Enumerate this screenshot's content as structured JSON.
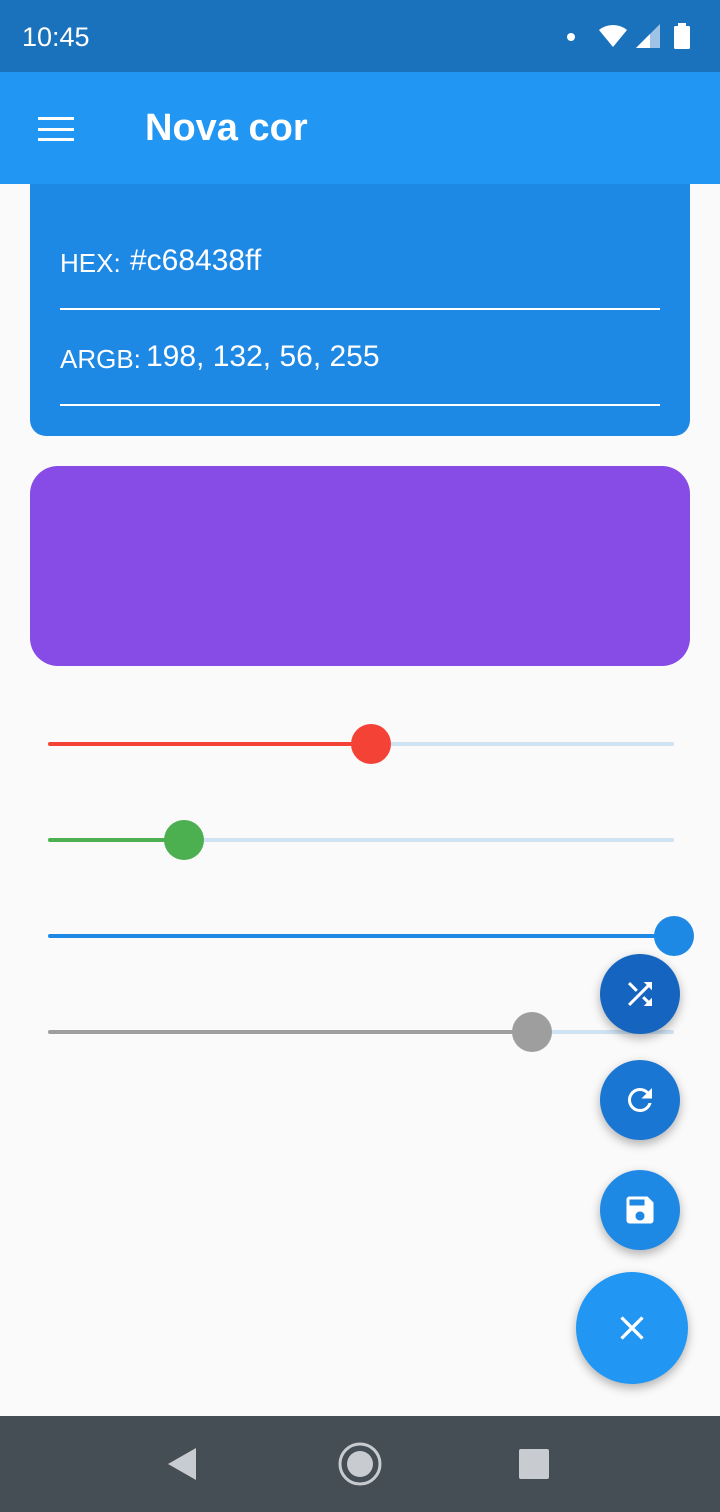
{
  "status_bar": {
    "time": "10:45"
  },
  "app_bar": {
    "title": "Nova cor"
  },
  "color_info": {
    "hex_label": "HEX:",
    "hex_value": "#c68438ff",
    "argb_label": "ARGB:",
    "argb_value": "198, 132, 56, 255"
  },
  "preview": {
    "color": "#874be6"
  },
  "sliders": [
    {
      "channel": "red",
      "color": "#f44336",
      "value": 0.516
    },
    {
      "channel": "green",
      "color": "#4caf50",
      "value": 0.218
    },
    {
      "channel": "blue",
      "color": "#1e88e5",
      "value": 1.0
    },
    {
      "channel": "alpha",
      "color": "#9e9e9e",
      "value": 0.773
    }
  ],
  "fabs": [
    {
      "action": "shuffle",
      "icon": "shuffle-icon",
      "color": "#1565c0"
    },
    {
      "action": "refresh",
      "icon": "refresh-icon",
      "color": "#1976d2"
    },
    {
      "action": "save",
      "icon": "save-icon",
      "color": "#1e88e5"
    },
    {
      "action": "close",
      "icon": "close-icon",
      "color": "#2196f3"
    }
  ],
  "colors": {
    "status_bar": "#1a72bd",
    "app_bar": "#2196f3",
    "info_card": "#1e88e5",
    "nav_bar": "#454d55"
  }
}
